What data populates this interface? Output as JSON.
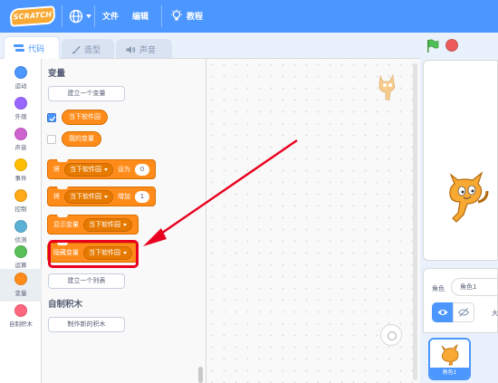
{
  "menubar": {
    "logo": "SCRATCH",
    "file": "文件",
    "edit": "编辑",
    "tutorials": "教程"
  },
  "tabs": [
    {
      "label": "代码"
    },
    {
      "label": "造型"
    },
    {
      "label": "声音"
    }
  ],
  "categories": [
    {
      "label": "运动",
      "color": "#4c97ff"
    },
    {
      "label": "外观",
      "color": "#9966ff"
    },
    {
      "label": "声音",
      "color": "#cf63cf"
    },
    {
      "label": "事件",
      "color": "#ffbf00"
    },
    {
      "label": "控制",
      "color": "#ffab19"
    },
    {
      "label": "侦测",
      "color": "#5cb1d6"
    },
    {
      "label": "运算",
      "color": "#59c059"
    },
    {
      "label": "变量",
      "color": "#ff8c1a"
    },
    {
      "label": "自制积木",
      "color": "#ff6680"
    }
  ],
  "palette": {
    "variables_title": "变量",
    "make_variable": "建立一个变量",
    "var_1": "当下软件园",
    "var_2": "我的变量",
    "set_block": {
      "prefix": "将",
      "var": "当下软件园",
      "mid": "设为",
      "value": "0"
    },
    "change_block": {
      "prefix": "将",
      "var": "当下软件园",
      "mid": "增加",
      "value": "1"
    },
    "show_block": {
      "prefix": "显示变量",
      "var": "当下软件园"
    },
    "hide_block": {
      "prefix": "隐藏变量",
      "var": "当下软件园"
    },
    "make_list": "建立一个列表",
    "my_blocks_title": "自制积木",
    "make_block": "制作新的积木"
  },
  "sprite_panel": {
    "sprite_label": "角色",
    "sprite_name": "角色1",
    "size_label": "大",
    "tile_label": "角色1"
  },
  "colors": {
    "menubar": "#4c97ff",
    "variables": "#ff8c1a",
    "highlight": "#e8001e"
  }
}
